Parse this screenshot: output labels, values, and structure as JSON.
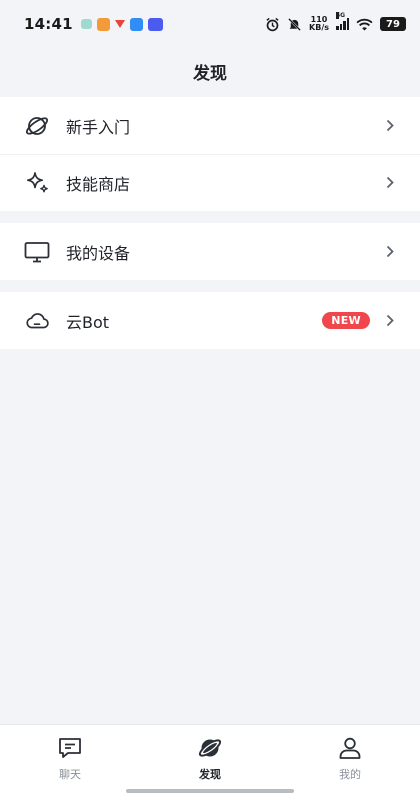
{
  "status_bar": {
    "time": "14:41",
    "net_speed_value": "110",
    "net_speed_unit": "KB/s",
    "signal_label": "5G",
    "battery": "79",
    "notification_icons": [
      "app-icon-teal",
      "app-icon-orange",
      "app-icon-red-arrow",
      "app-icon-blue",
      "app-icon-indigo"
    ],
    "system_icons": [
      "alarm-icon",
      "mute-icon",
      "signal-icon",
      "wifi-icon",
      "battery-icon"
    ]
  },
  "header": {
    "title": "发现"
  },
  "menu_groups": [
    {
      "items": [
        {
          "label": "新手入门",
          "icon": "planet-icon"
        },
        {
          "label": "技能商店",
          "icon": "sparkle-icon"
        }
      ]
    },
    {
      "items": [
        {
          "label": "我的设备",
          "icon": "monitor-icon"
        }
      ]
    },
    {
      "items": [
        {
          "label": "云Bot",
          "icon": "cloud-icon",
          "badge": "NEW"
        }
      ]
    }
  ],
  "tabbar": {
    "tabs": [
      {
        "label": "聊天",
        "icon": "chat-icon",
        "active": false
      },
      {
        "label": "发现",
        "icon": "planet-icon",
        "active": true
      },
      {
        "label": "我的",
        "icon": "user-icon",
        "active": false
      }
    ]
  },
  "colors": {
    "background": "#f2f4f8",
    "badge": "#f0474d",
    "text_primary": "#1f2329",
    "text_secondary": "#8a8f99"
  }
}
